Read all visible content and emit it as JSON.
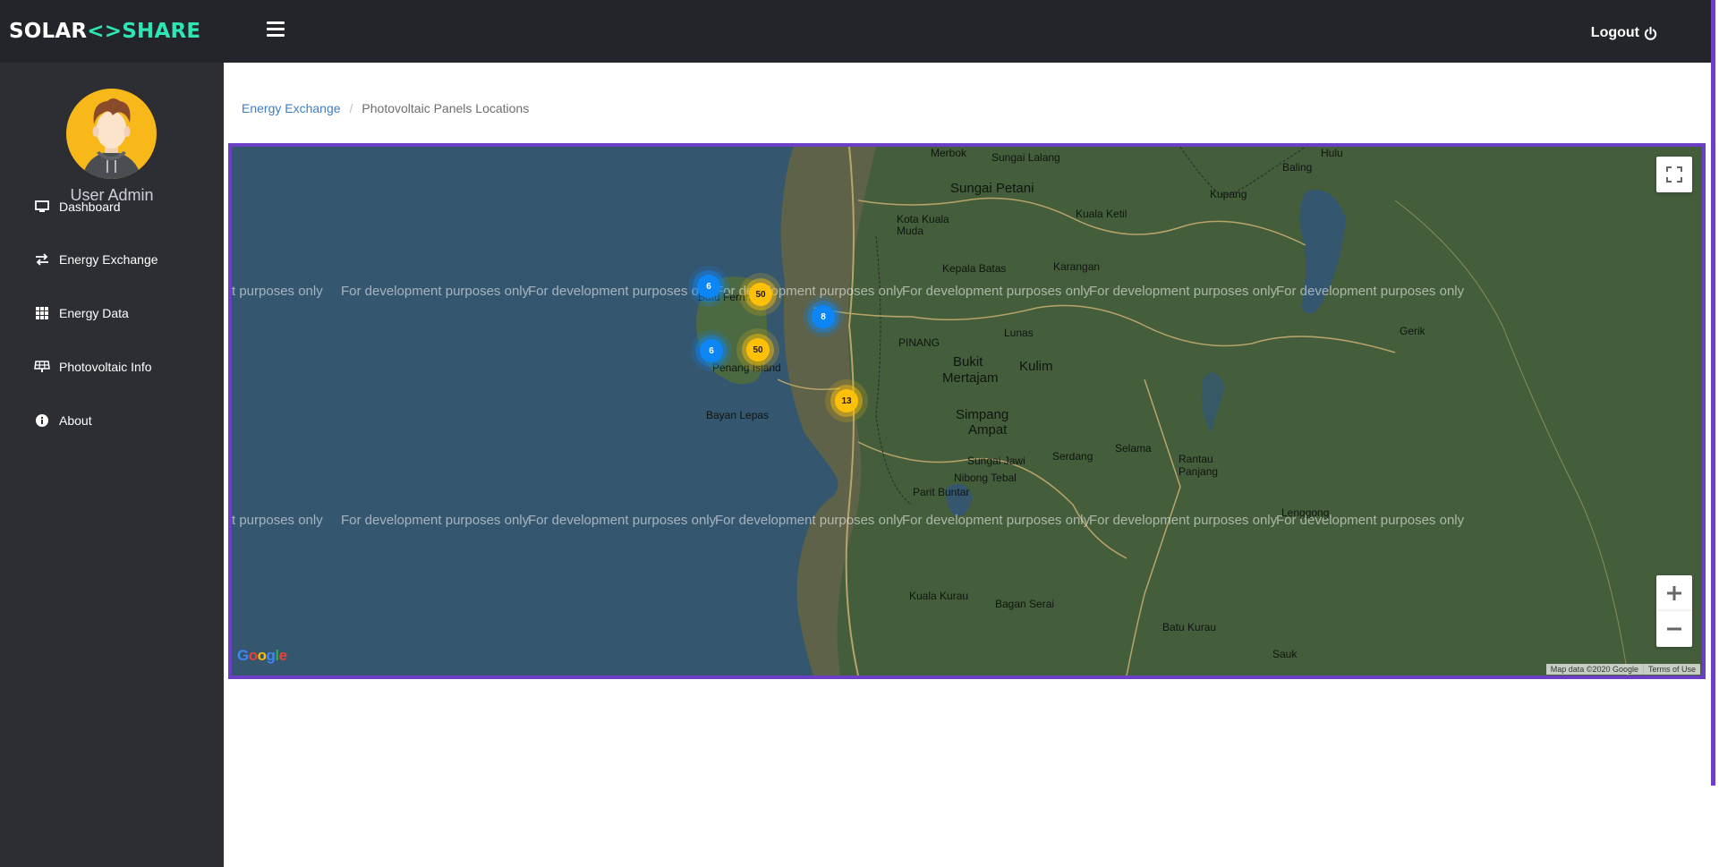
{
  "brand": {
    "part1": "SOLAR",
    "sep": "<>",
    "part2": "SHARE",
    "accent": "#2ee6b4"
  },
  "header": {
    "logout_label": "Logout"
  },
  "user": {
    "name": "User Admin"
  },
  "sidebar": {
    "items": [
      {
        "label": "Dashboard",
        "icon": "monitor-icon"
      },
      {
        "label": "Energy Exchange",
        "icon": "exchange-arrows-icon"
      },
      {
        "label": "Energy Data",
        "icon": "grid-icon"
      },
      {
        "label": "Photovoltaic Info",
        "icon": "solar-panel-icon"
      },
      {
        "label": "About",
        "icon": "info-circle-icon"
      }
    ]
  },
  "breadcrumb": {
    "parent": "Energy Exchange",
    "separator": "/",
    "current": "Photovoltaic Panels Locations"
  },
  "map": {
    "watermark": "For development purposes only",
    "watermark_cut": "t purposes only",
    "clusters": [
      {
        "count": "6",
        "color": "blue"
      },
      {
        "count": "50",
        "color": "yellow"
      },
      {
        "count": "8",
        "color": "blue"
      },
      {
        "count": "6",
        "color": "blue"
      },
      {
        "count": "50",
        "color": "yellow"
      },
      {
        "count": "13",
        "color": "yellow"
      }
    ],
    "places": {
      "merbok": "Merbok",
      "sungai_lalang": "Sungai Lalang",
      "sungai_petani": "Sungai Petani",
      "kota_kuala_muda": "Kota Kuala\nMuda",
      "kuala_ketil": "Kuala Ketil",
      "baling": "Baling",
      "hulu": "Hulu",
      "kupang": "Kupang",
      "karangan": "Karangan",
      "kepala_batas": "Kepala Batas",
      "batu_ferringhi": "Batu Ferringhi",
      "penang_island": "Penang Island",
      "bayan_lepas": "Bayan Lepas",
      "bukit": "Bukit",
      "mertajam": "Mertajam",
      "kulim": "Kulim",
      "lunas": "Lunas",
      "simpang": "Simpang",
      "ampat": "Ampat",
      "sungai_jawi": "Sungai Jawi",
      "nibong_tebal": "Nibong Tebal",
      "parit_buntar": "Parit Buntar",
      "serdang": "Serdang",
      "selama": "Selama",
      "rantau": "Rantau",
      "panjang": "Panjang",
      "lenggong": "Lenggong",
      "gerik": "Gerik",
      "kuala_kurau": "Kuala Kurau",
      "bagan_serai": "Bagan Serai",
      "batu_kurau": "Batu Kurau",
      "sauk": "Sauk",
      "pinang": "PINANG"
    },
    "attribution": {
      "data": "Map data ©2020 Google",
      "terms": "Terms of Use"
    },
    "logo": "Google"
  }
}
